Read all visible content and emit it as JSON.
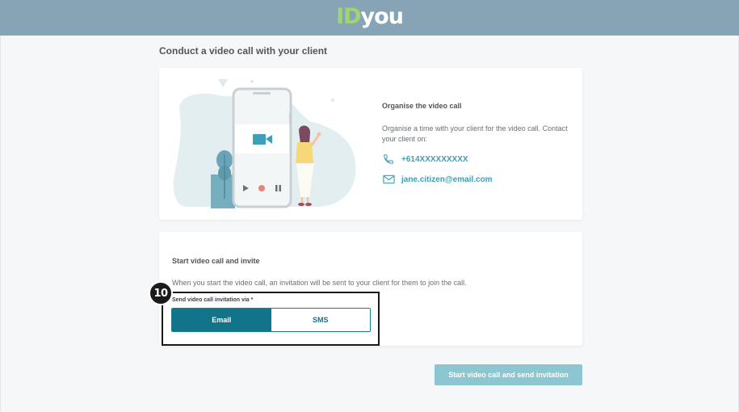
{
  "header": {
    "logo_id": "ID",
    "logo_you": "you"
  },
  "page": {
    "title": "Conduct a video call with your client"
  },
  "organise": {
    "title": "Organise the video call",
    "description": "Organise a time with your client for the video call. Contact your client on:",
    "phone": "+614XXXXXXXXX",
    "email": "jane.citizen@email.com"
  },
  "invite": {
    "title": "Start video call and invite",
    "description": "When you start the video call, an invitation will be sent to your client for them to join the call.",
    "via_label": "Send video call invitation via *",
    "options": [
      "Email",
      "SMS"
    ],
    "selected": "Email"
  },
  "annotation": {
    "step": "10"
  },
  "actions": {
    "start_label": "Start video call and send invitation"
  },
  "colors": {
    "header": "#86a4b6",
    "logo_id": "#9fd472",
    "accent": "#127489",
    "link": "#3d9fb8",
    "primary_disabled": "#8cc6d1"
  },
  "icons": [
    "phone-icon",
    "mail-icon",
    "video-camera-icon"
  ]
}
